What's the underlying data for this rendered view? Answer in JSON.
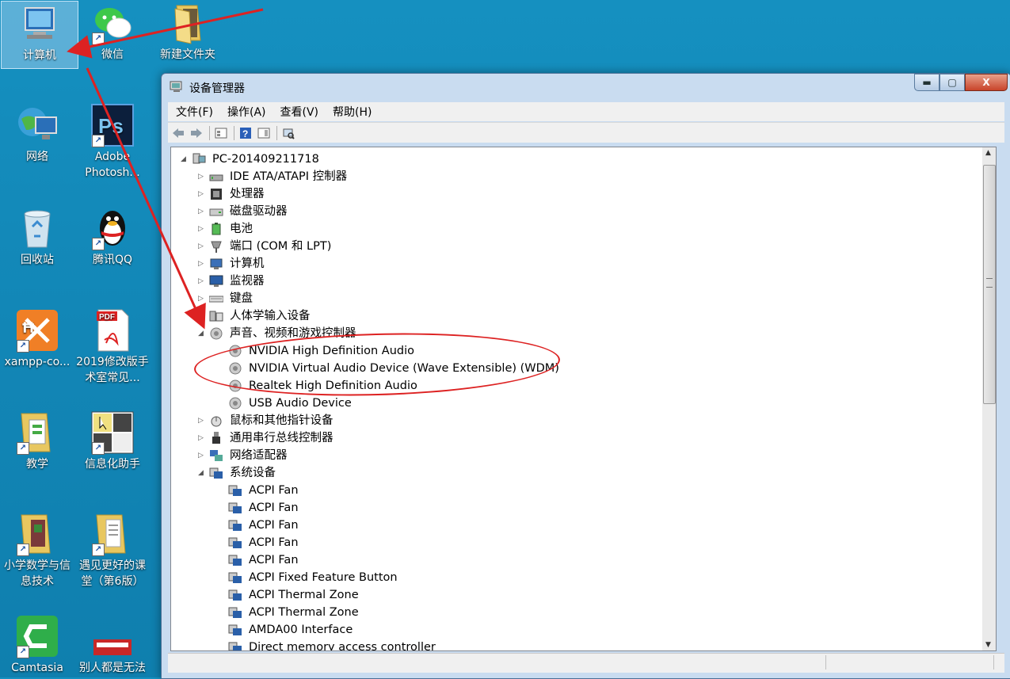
{
  "desktop": {
    "icons": [
      {
        "label": "计算机"
      },
      {
        "label": "微信"
      },
      {
        "label": "新建文件夹"
      },
      {
        "label": "网络"
      },
      {
        "label": "Adobe Photosh..."
      },
      {
        "label": "回收站"
      },
      {
        "label": "腾讯QQ"
      },
      {
        "label": "xampp-co..."
      },
      {
        "label": "2019修改版手术室常见..."
      },
      {
        "label": "教学"
      },
      {
        "label": "信息化助手"
      },
      {
        "label": "小学数学与信息技术"
      },
      {
        "label": "遇见更好的课堂（第6版）"
      },
      {
        "label": "Camtasia"
      },
      {
        "label": "别人都是无法"
      }
    ]
  },
  "window": {
    "title": "设备管理器",
    "controls": {
      "minimize": "▬",
      "maximize": "▢",
      "close": "X"
    }
  },
  "menu": [
    "文件(F)",
    "操作(A)",
    "查看(V)",
    "帮助(H)"
  ],
  "tree": {
    "root": "PC-201409211718",
    "categories": [
      "IDE ATA/ATAPI 控制器",
      "处理器",
      "磁盘驱动器",
      "电池",
      "端口 (COM 和 LPT)",
      "计算机",
      "监视器",
      "键盘",
      "人体学输入设备",
      "声音、视频和游戏控制器",
      "鼠标和其他指针设备",
      "通用串行总线控制器",
      "网络适配器",
      "系统设备"
    ],
    "sound_devices": [
      "NVIDIA High Definition Audio",
      "NVIDIA Virtual Audio Device (Wave Extensible) (WDM)",
      "Realtek High Definition Audio",
      "USB Audio Device"
    ],
    "system_devices": [
      "ACPI Fan",
      "ACPI Fan",
      "ACPI Fan",
      "ACPI Fan",
      "ACPI Fan",
      "ACPI Fixed Feature Button",
      "ACPI Thermal Zone",
      "ACPI Thermal Zone",
      "AMDA00 Interface",
      "Direct memory access controller"
    ]
  },
  "colors": {
    "desktop": "#1289b8",
    "annotation": "#dd2222",
    "window_frame": "#c9dcf0"
  }
}
